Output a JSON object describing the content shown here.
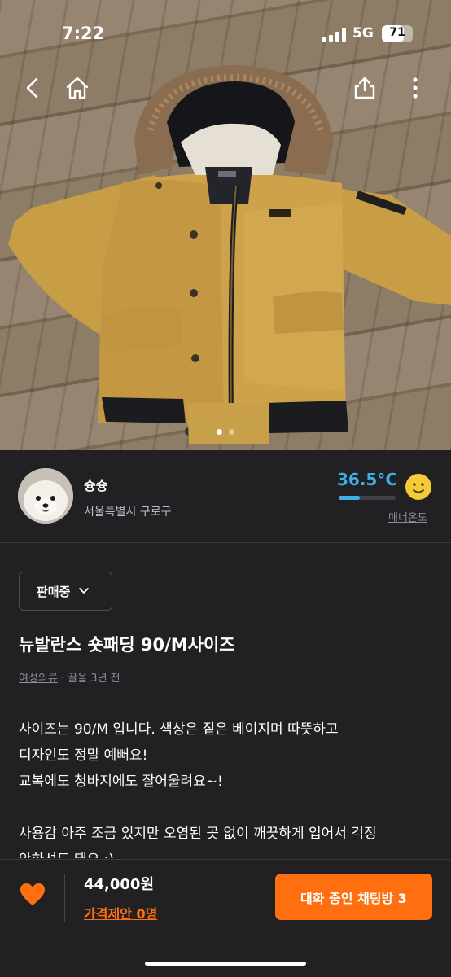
{
  "status_bar": {
    "time": "7:22",
    "network": "5G",
    "battery": "71",
    "battery_level": 0.71
  },
  "nav": {
    "back_icon": "chevron-left-icon",
    "home_icon": "home-icon",
    "share_icon": "share-icon",
    "more_icon": "more-vertical-icon"
  },
  "gallery": {
    "image_count": 2,
    "active_index": 0
  },
  "seller": {
    "name": "슝슝",
    "location": "서울특별시 구로구",
    "temperature": "36.5°C",
    "temperature_level": 0.365,
    "manner_label": "매너온도",
    "temperature_color": "#3fb0e6"
  },
  "product": {
    "status": "판매중",
    "title": "뉴발란스 숏패딩 90/M사이즈",
    "category": "여성의류",
    "time_ago": "· 끌올 3년 전",
    "description": [
      "사이즈는 90/M 입니다. 색상은 짙은 베이지며 따뜻하고",
      "디자인도 정말 예뻐요!",
      "교복에도 청바지에도 잘어울려요~!",
      "",
      "사용감 아주 조금 있지만 오염된 곳 없이 깨끗하게 입어서 걱정",
      "안하셔도 돼요 :)"
    ]
  },
  "bottom_bar": {
    "price": "44,000원",
    "price_offer": "가격제안 0명",
    "chat_button": "대화 중인 채팅방 3",
    "accent_color": "#ff6f0f"
  }
}
